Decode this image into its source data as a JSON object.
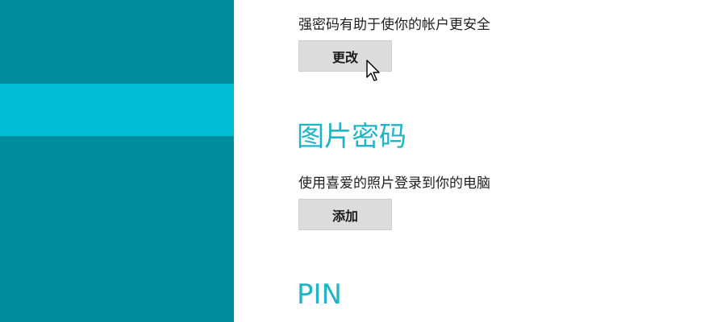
{
  "password": {
    "description": "强密码有助于使你的帐户更安全",
    "change_button": "更改"
  },
  "picture_password": {
    "title": "图片密码",
    "description": "使用喜爱的照片登录到你的电脑",
    "add_button": "添加"
  },
  "pin": {
    "title": "PIN"
  },
  "colors": {
    "sidebar": "#008c9d",
    "sidebar_selected": "#00bcd4",
    "section_title": "#1fb4c8",
    "button_bg": "#dcdcdc"
  },
  "icons": {
    "cursor": "mouse-pointer-icon"
  }
}
